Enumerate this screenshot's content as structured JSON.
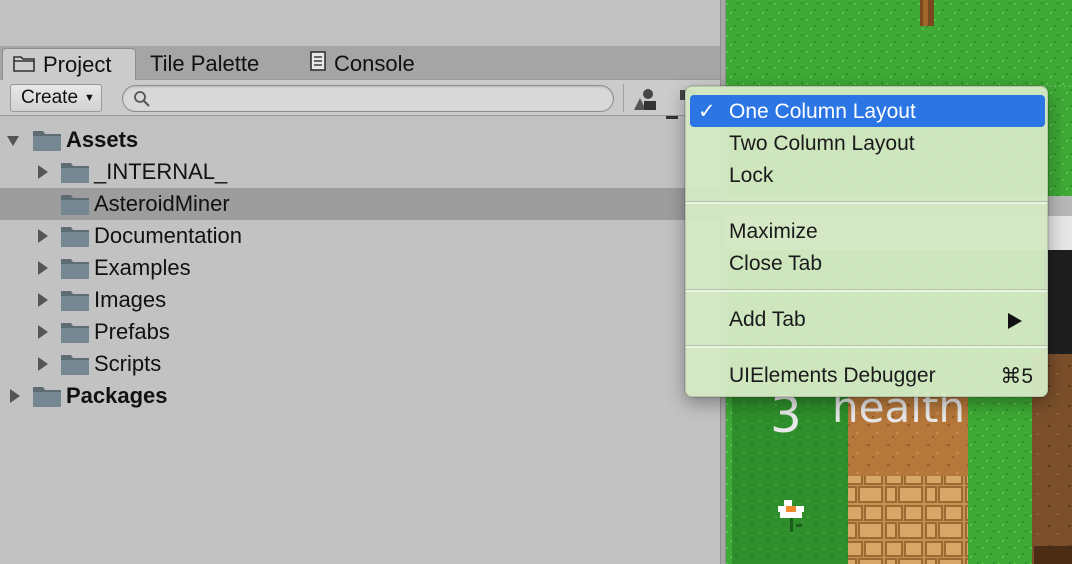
{
  "tabs": [
    {
      "label": "Project",
      "icon": "folder-tab-icon",
      "active": true
    },
    {
      "label": "Tile Palette",
      "icon": null,
      "active": false
    },
    {
      "label": "Console",
      "icon": "console-icon",
      "active": false
    }
  ],
  "toolbar": {
    "create_label": "Create",
    "search": {
      "value": "",
      "placeholder": ""
    }
  },
  "tree": [
    {
      "label": "Assets",
      "bold": true,
      "expanded": true,
      "level": 0,
      "selected": false
    },
    {
      "label": "_INTERNAL_",
      "bold": false,
      "expanded": false,
      "level": 1,
      "selected": false
    },
    {
      "label": "AsteroidMiner",
      "bold": false,
      "expanded": null,
      "level": 1,
      "selected": true
    },
    {
      "label": "Documentation",
      "bold": false,
      "expanded": false,
      "level": 1,
      "selected": false
    },
    {
      "label": "Examples",
      "bold": false,
      "expanded": false,
      "level": 1,
      "selected": false
    },
    {
      "label": "Images",
      "bold": false,
      "expanded": false,
      "level": 1,
      "selected": false
    },
    {
      "label": "Prefabs",
      "bold": false,
      "expanded": false,
      "level": 1,
      "selected": false
    },
    {
      "label": "Scripts",
      "bold": false,
      "expanded": false,
      "level": 1,
      "selected": false
    },
    {
      "label": "Packages",
      "bold": true,
      "expanded": false,
      "level": 0,
      "selected": false
    }
  ],
  "context_menu": {
    "items": [
      {
        "label": "One Column Layout",
        "checked": true,
        "highlighted": true
      },
      {
        "label": "Two Column Layout"
      },
      {
        "label": "Lock"
      },
      {
        "label": "Maximize"
      },
      {
        "label": "Close Tab"
      },
      {
        "label": "Add Tab",
        "submenu": true
      },
      {
        "label": "UIElements Debugger",
        "shortcut": "⌘5"
      }
    ]
  },
  "scene": {
    "health_value": "3",
    "health_label": "health"
  },
  "colors": {
    "menu_highlight": "#2b76e4",
    "menu_background": "#d4e8c4",
    "grass": "#3ea935",
    "dirt": "#b5773a",
    "panel": "#c2c2c2"
  }
}
